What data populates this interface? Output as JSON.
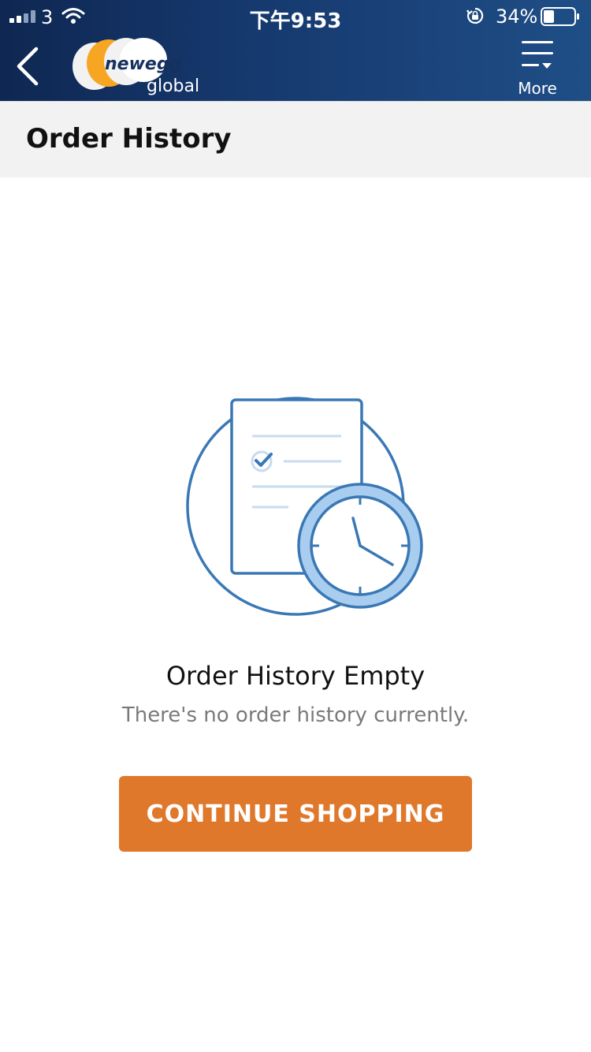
{
  "status_bar": {
    "carrier": "3",
    "time": "下午9:53",
    "battery_percent": "34%",
    "battery_level": 0.34
  },
  "nav": {
    "logo_text_main": "newegg",
    "logo_text_sub": "global",
    "more_label": "More"
  },
  "page": {
    "title": "Order History"
  },
  "empty_state": {
    "title": "Order History Empty",
    "subtitle": "There's no order history currently.",
    "button_label": "CONTINUE SHOPPING"
  },
  "colors": {
    "header_dark": "#0f2752",
    "header_light": "#1f4e86",
    "accent_orange": "#e0782c",
    "illustration_blue": "#3a78b5",
    "illustration_light": "#a9cdef"
  }
}
